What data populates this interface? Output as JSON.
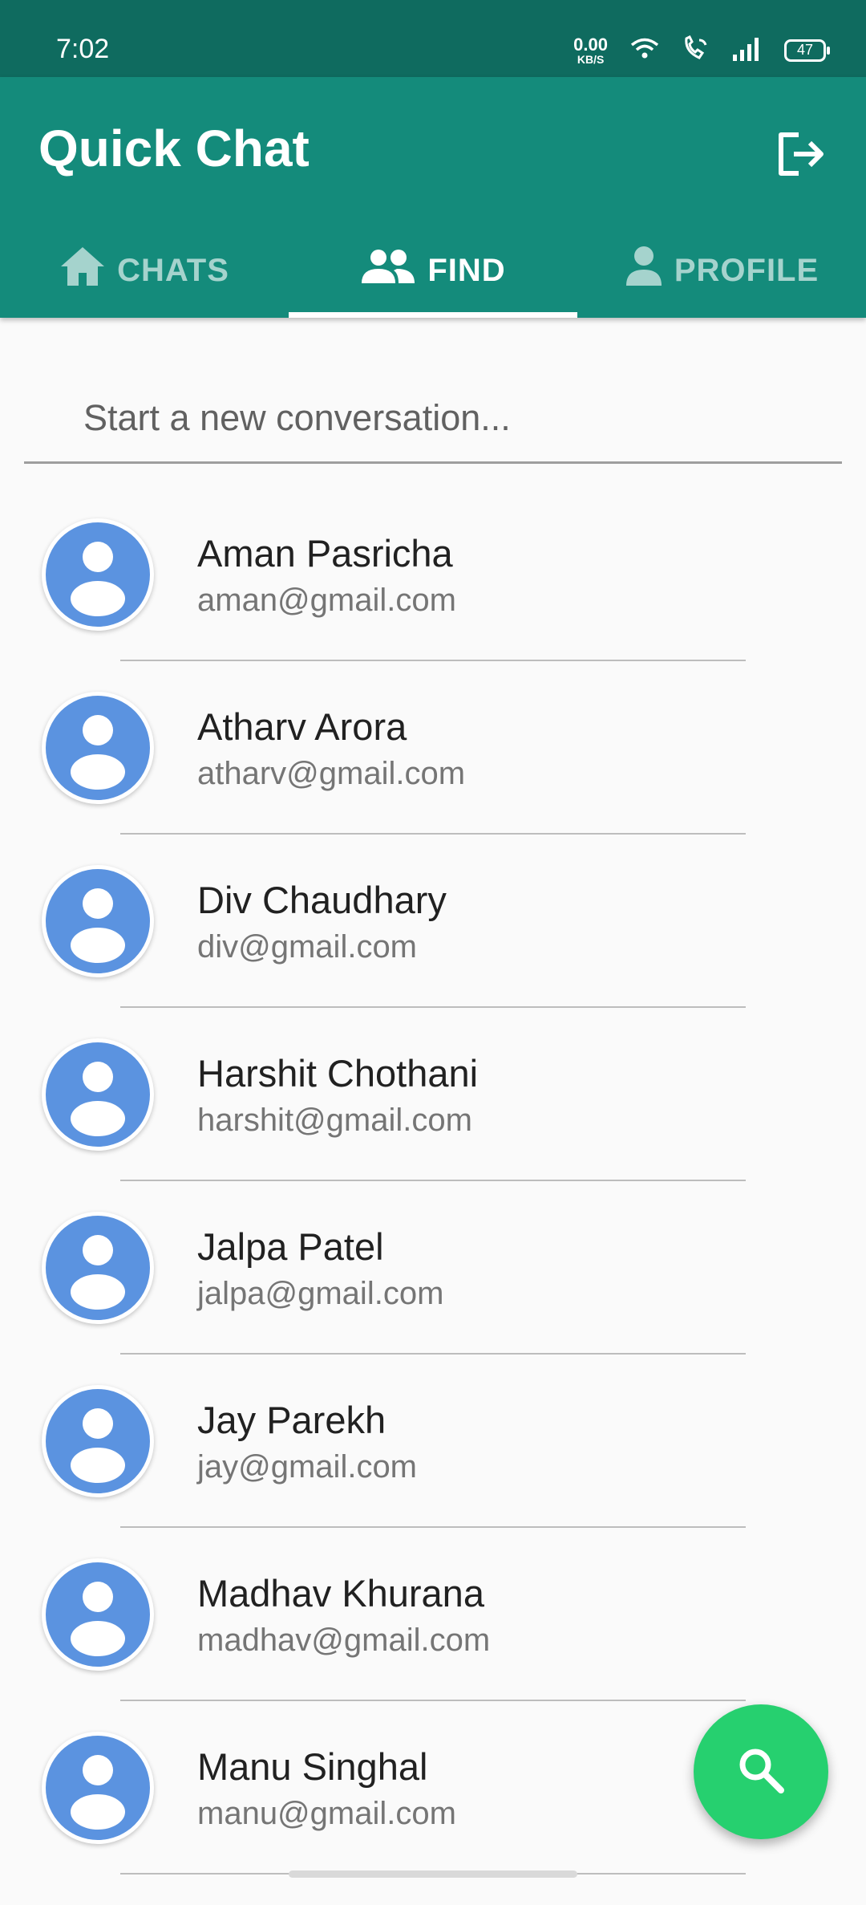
{
  "status_bar": {
    "time": "7:02",
    "net_speed_value": "0.00",
    "net_speed_unit": "KB/S",
    "battery": "47",
    "icons": [
      "wifi-icon",
      "wifi-call-icon",
      "signal-icon",
      "battery-icon"
    ]
  },
  "app_bar": {
    "title": "Quick Chat",
    "logout_icon": "logout-icon",
    "background": "#148b7b"
  },
  "tabs": [
    {
      "label": "CHATS",
      "icon": "home-icon",
      "active": false
    },
    {
      "label": "FIND",
      "icon": "people-icon",
      "active": true
    },
    {
      "label": "PROFILE",
      "icon": "person-icon",
      "active": false
    }
  ],
  "search": {
    "placeholder": "Start a new conversation...",
    "value": ""
  },
  "users": [
    {
      "name": "Aman Pasricha",
      "email": "aman@gmail.com"
    },
    {
      "name": "Atharv Arora",
      "email": "atharv@gmail.com"
    },
    {
      "name": "Div Chaudhary",
      "email": "div@gmail.com"
    },
    {
      "name": "Harshit Chothani",
      "email": "harshit@gmail.com"
    },
    {
      "name": "Jalpa Patel",
      "email": "jalpa@gmail.com"
    },
    {
      "name": "Jay Parekh",
      "email": "jay@gmail.com"
    },
    {
      "name": "Madhav Khurana",
      "email": "madhav@gmail.com"
    },
    {
      "name": "Manu Singhal",
      "email": "manu@gmail.com"
    }
  ],
  "fab": {
    "icon": "search-icon",
    "color": "#26d06f"
  },
  "colors": {
    "status_bar": "#0f6b5f",
    "avatar": "#5b93e0"
  }
}
